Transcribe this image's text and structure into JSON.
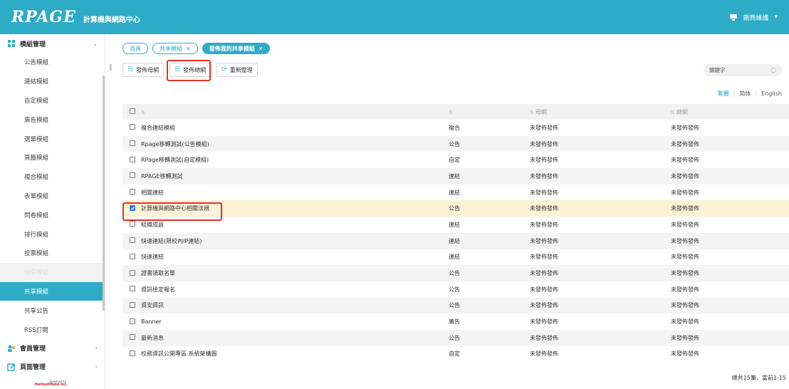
{
  "header": {
    "logo": "RPAGE",
    "site_title": "計算機與網路中心",
    "user_label": "廠商維護",
    "user_caret": "▾"
  },
  "sidebar": {
    "groups": [
      {
        "label": "模組管理",
        "chevron": "⌄"
      },
      {
        "label": "會員管理",
        "chevron": "›"
      },
      {
        "label": "頁面管理",
        "chevron": "›"
      }
    ],
    "items": [
      {
        "label": "公告模組"
      },
      {
        "label": "連結模組"
      },
      {
        "label": "自定模組"
      },
      {
        "label": "廣告模組"
      },
      {
        "label": "選單模組"
      },
      {
        "label": "頁籤模組"
      },
      {
        "label": "複合模組"
      },
      {
        "label": "表單模組"
      },
      {
        "label": "問卷模組"
      },
      {
        "label": "排行模組"
      },
      {
        "label": "投票模組"
      },
      {
        "label": "分享模組"
      },
      {
        "label": "共享模組"
      },
      {
        "label": "共享公告"
      },
      {
        "label": "RSS訂閱"
      }
    ],
    "powered_small": "Powered by",
    "powered_brand": "HelmetMate Inc."
  },
  "tabs": [
    {
      "label": "首頁",
      "closable": false
    },
    {
      "label": "共享模組",
      "closable": true
    },
    {
      "label": "發佈我的共享模組",
      "closable": true
    }
  ],
  "toolbar": {
    "publish_parent": "發佈母網",
    "publish_total": "發佈總網",
    "refresh": "重新整理"
  },
  "search": {
    "placeholder": "關鍵字"
  },
  "lang": {
    "trad": "繁體",
    "simp": "简体",
    "en": "English"
  },
  "table": {
    "headers": {
      "title": "",
      "type": "",
      "parent": "母網",
      "total": "總網"
    },
    "rows": [
      {
        "title": "複合連結模組",
        "type": "複合",
        "parent": "未發佈發佈",
        "total": "未發佈發佈",
        "checked": false
      },
      {
        "title": "Rpage移轉測試(公告模組)",
        "type": "公告",
        "parent": "未發佈發佈",
        "total": "未發佈發佈",
        "checked": false
      },
      {
        "title": "RPage移轉測試(自定模組)",
        "type": "自定",
        "parent": "未發佈發佈",
        "total": "未發佈發佈",
        "checked": false
      },
      {
        "title": "RPAGE移轉測試",
        "type": "連結",
        "parent": "未發佈發佈",
        "total": "未發佈發佈",
        "checked": false
      },
      {
        "title": "相關連結",
        "type": "連結",
        "parent": "未發佈發佈",
        "total": "未發佈發佈",
        "checked": false
      },
      {
        "title": "計算機與網路中心相關法規",
        "type": "公告",
        "parent": "未發佈發佈",
        "total": "未發佈發佈",
        "checked": true
      },
      {
        "title": "組織成員",
        "type": "連結",
        "parent": "未發佈發佈",
        "total": "未發佈發佈",
        "checked": false
      },
      {
        "title": "快速連結(限校內IP連結)",
        "type": "連結",
        "parent": "未發佈發佈",
        "total": "未發佈發佈",
        "checked": false
      },
      {
        "title": "快速連結",
        "type": "連結",
        "parent": "未發佈發佈",
        "total": "未發佈發佈",
        "checked": false
      },
      {
        "title": "證書領取名單",
        "type": "公告",
        "parent": "未發佈發佈",
        "total": "未發佈發佈",
        "checked": false
      },
      {
        "title": "資訊檢定報名",
        "type": "公告",
        "parent": "未發佈發佈",
        "total": "未發佈發佈",
        "checked": false
      },
      {
        "title": "資安資訊",
        "type": "公告",
        "parent": "未發佈發佈",
        "total": "未發佈發佈",
        "checked": false
      },
      {
        "title": "Banner",
        "type": "廣告",
        "parent": "未發佈發佈",
        "total": "未發佈發佈",
        "checked": false
      },
      {
        "title": "最新消息",
        "type": "公告",
        "parent": "未發佈發佈",
        "total": "未發佈發佈",
        "checked": false
      },
      {
        "title": "校務資訊公開專區 系統架構圖",
        "type": "自定",
        "parent": "未發佈發佈",
        "total": "未發佈發佈",
        "checked": false
      }
    ]
  },
  "footer": {
    "count": "總共15筆，當前1-15"
  },
  "colors": {
    "accent": "#2eabc6",
    "highlight": "#e4312b",
    "selected_row": "#fdf1d6"
  }
}
